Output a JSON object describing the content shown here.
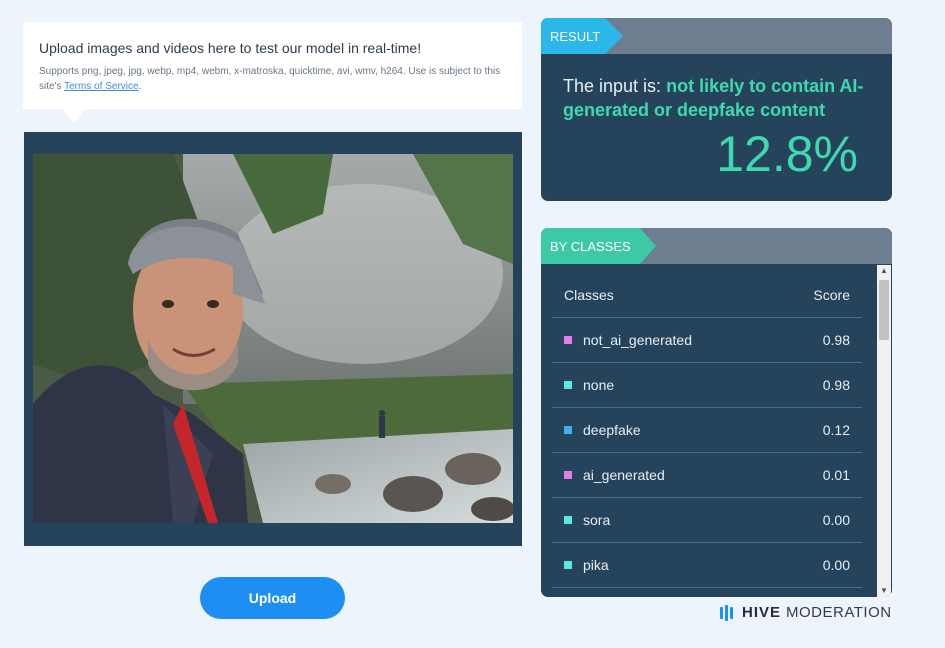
{
  "info": {
    "title": "Upload images and videos here to test our model in real-time!",
    "subtitle_prefix": "Supports png, jpeg, jpg, webp, mp4, webm, x-matroska, quicktime, avi, wmv, h264. Use is subject to this site's",
    "terms_link": "Terms of Service",
    "subtitle_suffix": "."
  },
  "upload_button": "Upload",
  "result": {
    "tag": "RESULT",
    "prefix": "The input is:",
    "verdict": "not likely to contain AI-generated or deepfake content",
    "percentage": "12.8%"
  },
  "classes": {
    "tag": "BY CLASSES",
    "col_class": "Classes",
    "col_score": "Score",
    "rows": [
      {
        "name": "not_ai_generated",
        "score": "0.98",
        "color": "#e27ee8"
      },
      {
        "name": "none",
        "score": "0.98",
        "color": "#5fe8e0"
      },
      {
        "name": "deepfake",
        "score": "0.12",
        "color": "#3fb2ee"
      },
      {
        "name": "ai_generated",
        "score": "0.01",
        "color": "#e27ee8"
      },
      {
        "name": "sora",
        "score": "0.00",
        "color": "#5fe8e0"
      },
      {
        "name": "pika",
        "score": "0.00",
        "color": "#5fe8e0"
      }
    ]
  },
  "logo": {
    "brand": "HIVE",
    "product": "MODERATION"
  },
  "colors": {
    "accent": "#1d8ff2",
    "teal": "#3fd9b0",
    "panel": "#25445c"
  }
}
